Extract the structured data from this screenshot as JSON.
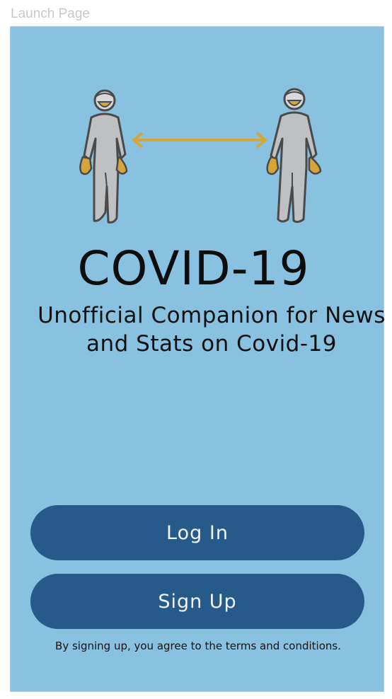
{
  "frame": {
    "label": "Launch Page"
  },
  "app": {
    "title": "COVID-19",
    "subtitle": "Unofficial Companion for News and Stats on Covid-19"
  },
  "actions": {
    "login_label": "Log In",
    "signup_label": "Sign Up"
  },
  "footer": {
    "terms_text": "By signing up, you agree to the terms and conditions."
  },
  "illustration": {
    "icon": "social-distancing-icon",
    "colors": {
      "background": "#89c1e1",
      "suit": "#bfc0c2",
      "outline": "#4a4a4a",
      "gloves_mask": "#d4a63a",
      "arrow": "#d4a63a"
    }
  },
  "colors": {
    "screen_background": "#89c1e1",
    "button": "#265a8b",
    "button_text": "#f1f4f7"
  }
}
